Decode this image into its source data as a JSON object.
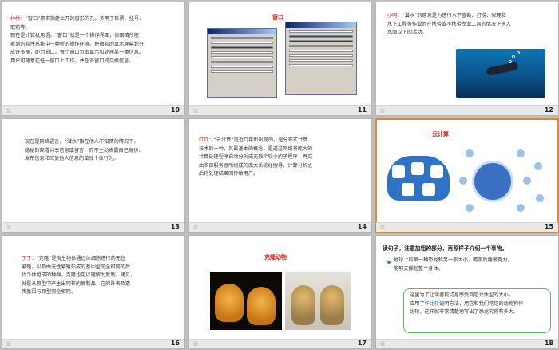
{
  "slides": [
    {
      "number": "10",
      "lines": [
        {
          "speaker": "林林：",
          "text": "“窗口”原来指建上开的窗形的孔，多用于售票、挂号、"
        },
        {
          "speaker": "",
          "text": "取药等。"
        },
        {
          "speaker": "",
          "text": "现在是计算机用语。“窗口”就是一个操作界面，你眼睛所能"
        },
        {
          "speaker": "",
          "text": "看到的软件系统中一种新的操作环境。把微软的显示屏幕划分"
        },
        {
          "speaker": "",
          "text": "成许多框，即为窗口。每个窗口负责显示和处理某一类信息。"
        },
        {
          "speaker": "",
          "text": "用户可随意在任一窗口上工作，并在各窗口间交换信息。"
        }
      ]
    },
    {
      "number": "11",
      "title": "窗口"
    },
    {
      "number": "12",
      "lines": [
        {
          "speaker": "小明：",
          "text": "“潜水”的原意是为进行水下查勘、打捞、修理和"
        },
        {
          "speaker": "",
          "text": "水下工程等作业而在携带或不携带专业工具的情况下进入"
        },
        {
          "speaker": "",
          "text": "水面以下的活动。"
        }
      ]
    },
    {
      "number": "13",
      "lines": [
        {
          "speaker": "",
          "text": "现在是网络语言，“潜水”指在他人不知情的情况下，"
        },
        {
          "speaker": "",
          "text": "隐秘的观看共享信息或留言，而不主动表露自己身份、"
        },
        {
          "speaker": "",
          "text": "发布信息和回复他人信息的单独个体行为。"
        }
      ]
    },
    {
      "number": "14",
      "lines": [
        {
          "speaker": "红红：",
          "text": "“云计算”是近几年新出现的，是分布式计算"
        },
        {
          "speaker": "",
          "text": "技术的一种，其最基本的概念，是透过网络将庞大的"
        },
        {
          "speaker": "",
          "text": "计算处理程序自动分拆成无数个较小的子程序，再交"
        },
        {
          "speaker": "",
          "text": "由多部服务器所组成的庞大系统经搜寻、计算分析之"
        },
        {
          "speaker": "",
          "text": "后将处理结果回传给用户。"
        }
      ]
    },
    {
      "number": "15",
      "title": "云计算"
    },
    {
      "number": "16",
      "lines": [
        {
          "speaker": "丁丁：",
          "text": "“克隆”是指生物体通过体细胞进行的无性"
        },
        {
          "speaker": "",
          "text": "繁殖，以及由无性繁殖形成的基因型完全相同的后"
        },
        {
          "speaker": "",
          "text": "代个体组成的种群。克隆也可以理解为复制、拷贝，"
        },
        {
          "speaker": "",
          "text": "就是从原型中产生出同样的复制品，它的外表及遗"
        },
        {
          "speaker": "",
          "text": "传基因与原型完全相同。"
        }
      ]
    },
    {
      "number": "17",
      "title": "克隆动物"
    },
    {
      "number": "18",
      "heading": "读句子，注意加粗的部分，再照样子介绍一个事物。",
      "bullet_line_1": "地球上的第一种恐龙和另一般大小，两条后腿很有力，",
      "bullet_line_2": "能够支撑起整个身体。",
      "note_line_1": "这里为了让读者能切身感受到恐龙体型的大小，",
      "note_line_2_a": "应用了",
      "note_line_2_b": "作比较",
      "note_line_2_c": "说明方法，用它和我们常见的动物狗作",
      "note_line_3": "比较，这样就非常清楚地写出了恐龙究竟有多大。"
    }
  ],
  "footer_mark": "㳂",
  "colors": {
    "accent_red": "#d9261c",
    "accent_blue": "#1a73c8",
    "selection": "#e08a2f"
  }
}
